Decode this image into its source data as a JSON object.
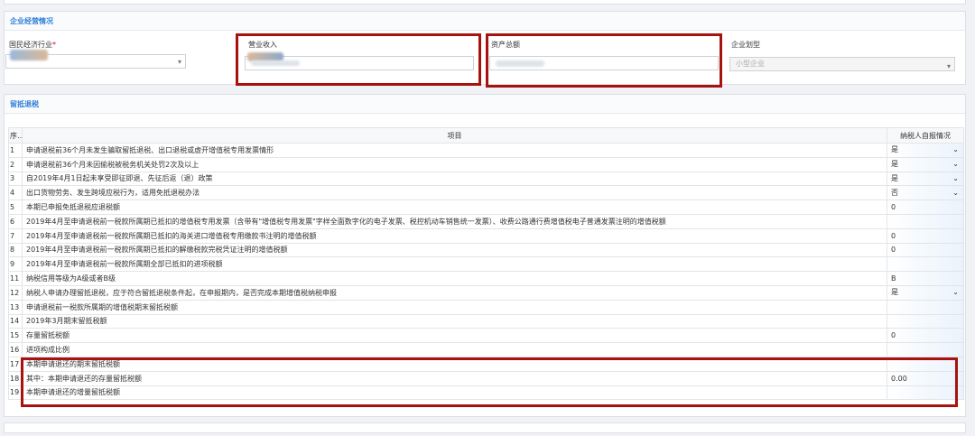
{
  "section1": {
    "title": "企业经营情况",
    "fields": [
      {
        "label": "国民经济行业",
        "required": true,
        "value": ""
      },
      {
        "label": "营业收入",
        "required": false,
        "value": ""
      },
      {
        "label": "资产总额",
        "required": false,
        "value": ""
      },
      {
        "label": "企业划型",
        "required": false,
        "value": "小型企业"
      }
    ]
  },
  "section2": {
    "title": "留抵退税",
    "columns": [
      "序号",
      "项目",
      "纳税人自报情况"
    ],
    "rows": [
      {
        "no": "1",
        "item": "申请退税前36个月未发生骗取留抵退税、出口退税或虚开增值税专用发票情形",
        "value": "是",
        "type": "select"
      },
      {
        "no": "2",
        "item": "申请退税前36个月未因偷税被税务机关处罚2次及以上",
        "value": "是",
        "type": "select"
      },
      {
        "no": "3",
        "item": "自2019年4月1日起未享受即征即退、先征后返（退）政策",
        "value": "是",
        "type": "select"
      },
      {
        "no": "4",
        "item": "出口货物劳务、发生跨境应税行为，适用免抵退税办法",
        "value": "否",
        "type": "select"
      },
      {
        "no": "5",
        "item": "本期已申报免抵退税应退税额",
        "value": "0",
        "type": "text"
      },
      {
        "no": "6",
        "item": "2019年4月至申请退税前一税款所属期已抵扣的增值税专用发票（含带有\"增值税专用发票\"字样全面数字化的电子发票、税控机动车销售统一发票）、收费公路通行费增值税电子普通发票注明的增值税额",
        "value": "",
        "type": "text"
      },
      {
        "no": "7",
        "item": "2019年4月至申请退税前一税款所属期已抵扣的海关进口增值税专用缴款书注明的增值税额",
        "value": "0",
        "type": "text"
      },
      {
        "no": "8",
        "item": "2019年4月至申请退税前一税款所属期已抵扣的解缴税款完税凭证注明的增值税额",
        "value": "0",
        "type": "text"
      },
      {
        "no": "9",
        "item": "2019年4月至申请退税前一税款所属期全部已抵扣的进项税额",
        "value": "",
        "type": "text"
      },
      {
        "no": "11",
        "item": "纳税信用等级为A级或者B级",
        "value": "B",
        "type": "text"
      },
      {
        "no": "12",
        "item": "纳税人申请办理留抵退税，应于符合留抵退税条件起，在申报期内，是否完成本期增值税纳税申报",
        "value": "是",
        "type": "select"
      },
      {
        "no": "13",
        "item": "申请退税前一税款所属期的增值税期末留抵税额",
        "value": "",
        "type": "text"
      },
      {
        "no": "14",
        "item": "2019年3月期末留抵税额",
        "value": "",
        "type": "text"
      },
      {
        "no": "15",
        "item": "存量留抵税额",
        "value": "0",
        "type": "text"
      },
      {
        "no": "16",
        "item": "进项构成比例",
        "value": "",
        "type": "text"
      },
      {
        "no": "17",
        "item": "本期申请退还的期末留抵税额",
        "value": "",
        "type": "text"
      },
      {
        "no": "18",
        "item": "其中：本期申请退还的存量留抵税额",
        "value": "0.00",
        "type": "text"
      },
      {
        "no": "19",
        "item": "本期申请退还的增量留抵税额",
        "value": "",
        "type": "text"
      }
    ]
  },
  "colors": {
    "highlight": "#a8120e",
    "section_title": "#2f7ed8",
    "required": "#e60012"
  },
  "icons": {
    "dropdown": "chevron-down-icon"
  }
}
